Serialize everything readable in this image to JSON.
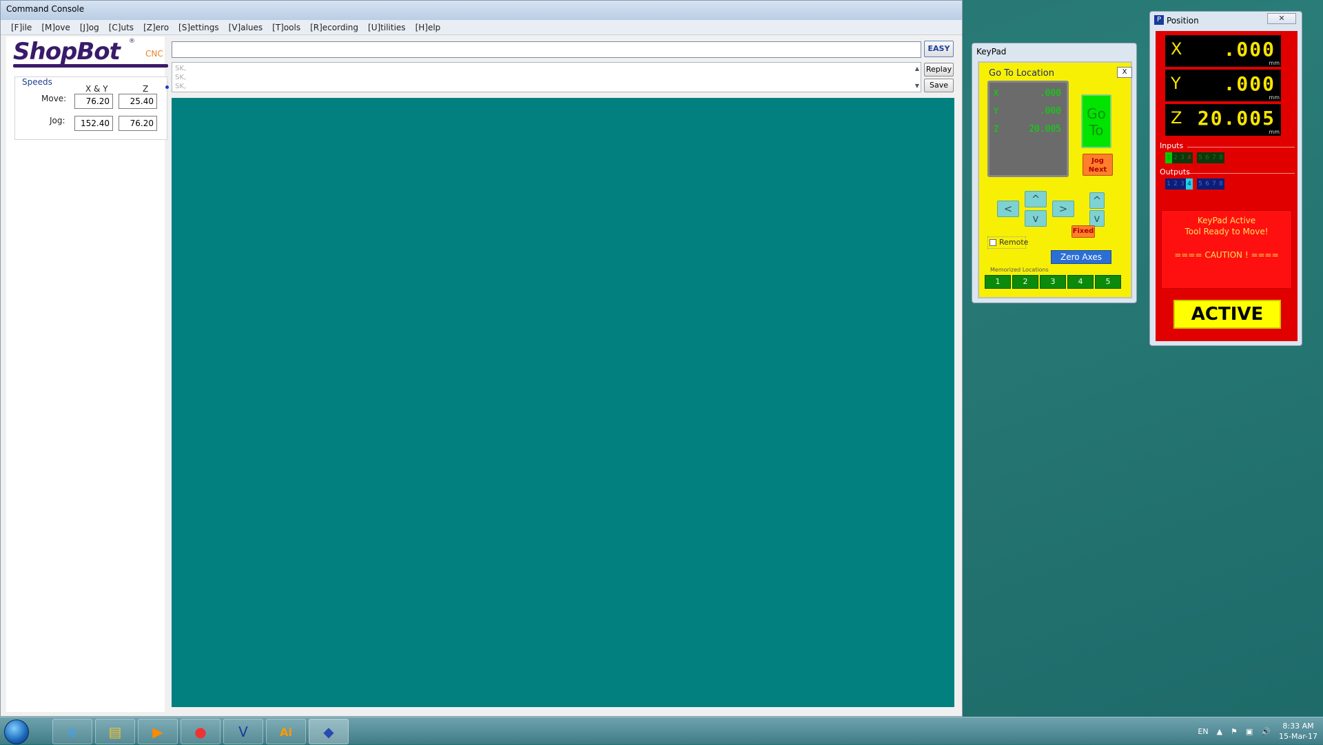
{
  "console": {
    "title": "Command Console",
    "menu": [
      "[F]ile",
      "[M]ove",
      "[J]og",
      "[C]uts",
      "[Z]ero",
      "[S]ettings",
      "[V]alues",
      "[T]ools",
      "[R]ecording",
      "[U]tilities",
      "[H]elp"
    ],
    "logo": {
      "brand": "ShopBot",
      "cnc": "CNC",
      "reg": "®"
    },
    "speeds": {
      "title": "Speeds",
      "col_xy": "X & Y",
      "col_z": "Z",
      "move_label": "Move:",
      "jog_label": "Jog:",
      "move_xy": "76.20",
      "move_z": "25.40",
      "jog_xy": "152.40",
      "jog_z": "76.20"
    },
    "command_input": {
      "value": ""
    },
    "easy_label": "EASY",
    "history": [
      "SK,",
      "SK,",
      "SK,"
    ],
    "replay_label": "Replay",
    "save_label": "Save"
  },
  "keypad": {
    "title": "KeyPad",
    "goto_label": "Go To Location",
    "close_label": "X",
    "display": {
      "x_label": "X",
      "y_label": "Y",
      "z_label": "Z",
      "x_val": ".000",
      "y_val": ".000",
      "z_val": "20.005"
    },
    "goto_button": "Go To",
    "jog_next": "Jog Next",
    "arrows": {
      "left": "<",
      "right": ">",
      "up": "^",
      "down": "v",
      "z_up": "^",
      "z_down": "v"
    },
    "fixed_label": "Fixed",
    "remote_label": "Remote",
    "zero_axes_label": "Zero Axes",
    "memorized_label": "Memorized Locations",
    "memory_slots": [
      "1",
      "2",
      "3",
      "4",
      "5"
    ]
  },
  "position": {
    "title": "Position",
    "close_label": "✕",
    "x": {
      "axis": "X",
      "value": ".000",
      "unit": "mm"
    },
    "y": {
      "axis": "Y",
      "value": ".000",
      "unit": "mm"
    },
    "z": {
      "axis": "Z",
      "value": "20.005",
      "unit": "mm"
    },
    "inputs_label": "Inputs",
    "inputs": [
      "1",
      "2",
      "3",
      "4",
      "5",
      "6",
      "7",
      "8"
    ],
    "outputs_label": "Outputs",
    "outputs": [
      "1",
      "2",
      "3",
      "4",
      "5",
      "6",
      "7",
      "8"
    ],
    "status": {
      "line1": "KeyPad Active",
      "line2": "Tool Ready to Move!",
      "line3": "==== CAUTION ! ===="
    },
    "active_label": "ACTIVE"
  },
  "taskbar": {
    "language": "EN",
    "time": "8:33 AM",
    "date": "15-Mar-17"
  },
  "colors": {
    "canvas": "#028080",
    "keypad_bg": "#f7f005",
    "position_bg": "#e00000",
    "dro_text": "#f7e400"
  }
}
